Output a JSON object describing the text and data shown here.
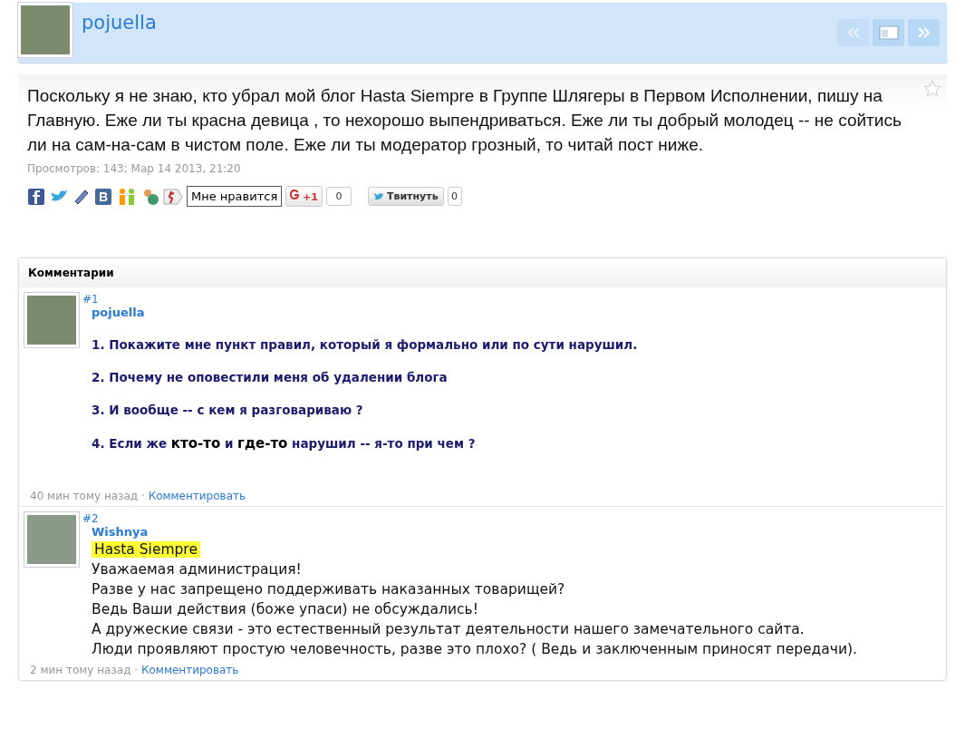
{
  "header": {
    "author": "pojuella"
  },
  "post": {
    "text": "Поскольку я не знаю, кто убрал мой блог Hasta Siempre в Группе Шлягеры в Первом Исполнении, пишу на Главную. Еже ли ты красна девица , то нехорошо выпендриваться. Еже ли ты добрый молодец -- не сойтись ли на сам-на-сам в чистом поле. Еже ли ты модератор грозный, то читай пост ниже.",
    "meta": "Просмотров: 143; Мар 14 2013, 21:20"
  },
  "share": {
    "like_label": "Мне нравится",
    "plusone_label": "+1",
    "plusone_count": "0",
    "tweet_label": "Твитнуть",
    "tweet_count": "0"
  },
  "comments_title": "Комментарии",
  "comments": [
    {
      "number": "#1",
      "author": "pojuella",
      "kind": "numbered",
      "lines": [
        [
          {
            "text": "1. Покажите мне пункт правил, который я формально или по сути нарушил.",
            "kind": "plain"
          }
        ],
        [
          {
            "text": "2. Почему не оповестили меня об удалении блога",
            "kind": "plain"
          }
        ],
        [
          {
            "text": "3. И вообще -- с кем я разговариваю ?",
            "kind": "plain"
          }
        ],
        [
          {
            "text": "4. Если же ",
            "kind": "plain"
          },
          {
            "text": "кто-то",
            "kind": "strong"
          },
          {
            "text": " и ",
            "kind": "plain"
          },
          {
            "text": "где-то",
            "kind": "strong"
          },
          {
            "text": " нарушил -- я-то при чем ?",
            "kind": "plain"
          }
        ]
      ],
      "time": "40 мин тому назад",
      "separator": "·",
      "reply": "Комментировать"
    },
    {
      "number": "#2",
      "author": "Wishnya",
      "kind": "plain",
      "lines": [
        [
          {
            "text": "Hasta Siempre",
            "kind": "highlight"
          }
        ],
        [
          {
            "text": "Уважаемая администрация!",
            "kind": "plain"
          }
        ],
        [
          {
            "text": "Разве у нас запрещено поддерживать наказанных товарищей?",
            "kind": "plain"
          }
        ],
        [
          {
            "text": "Ведь Ваши действия (боже упаси) не обсуждались!",
            "kind": "plain"
          }
        ],
        [
          {
            "text": "А дружеские связи - это естественный результат деятельности нашего замечательного сайта.",
            "kind": "plain"
          }
        ],
        [
          {
            "text": "Люди проявляют простую человечность, разве это плохо? ( Ведь и заключенным приносят передачи).",
            "kind": "plain"
          }
        ]
      ],
      "time": "2 мин тому назад",
      "separator": "·",
      "reply": "Комментировать"
    }
  ]
}
